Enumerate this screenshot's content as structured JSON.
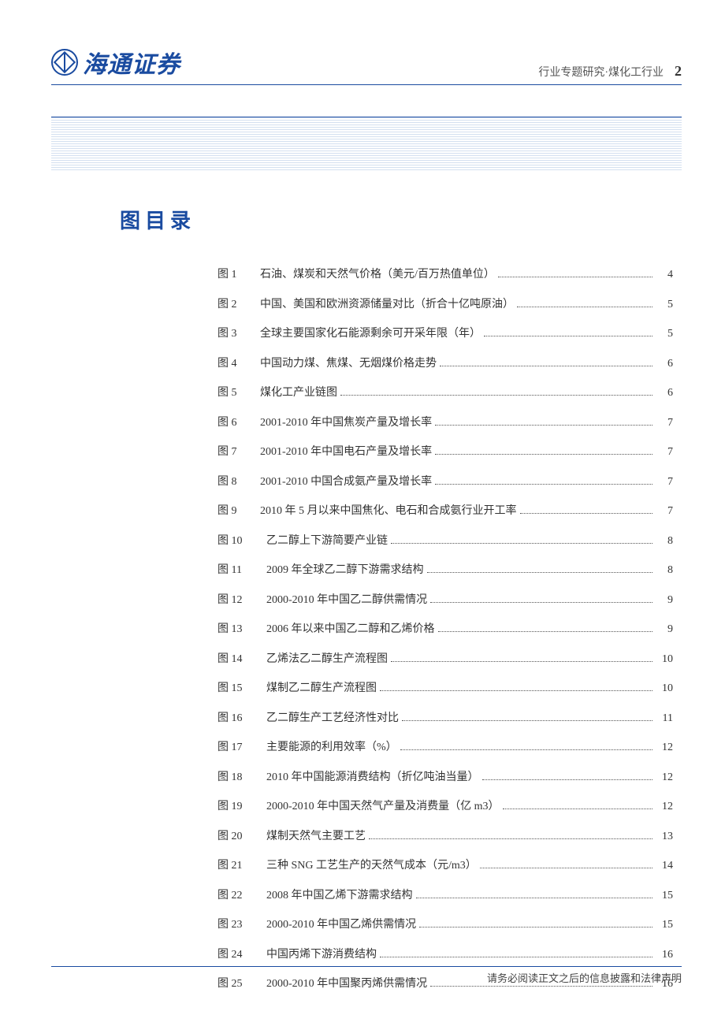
{
  "header": {
    "company": "海通证券",
    "category": "行业专题研究·煤化工行业",
    "page": "2"
  },
  "toc": {
    "title": "图目录",
    "entries": [
      {
        "label": "图 1",
        "text": "石油、煤炭和天然气价格（美元/百万热值单位）",
        "page": "4"
      },
      {
        "label": "图 2",
        "text": "中国、美国和欧洲资源储量对比（折合十亿吨原油）",
        "page": "5"
      },
      {
        "label": "图 3",
        "text": "全球主要国家化石能源剩余可开采年限（年）",
        "page": "5"
      },
      {
        "label": "图 4",
        "text": "中国动力煤、焦煤、无烟煤价格走势",
        "page": "6"
      },
      {
        "label": "图 5",
        "text": "煤化工产业链图",
        "page": "6"
      },
      {
        "label": "图 6",
        "text": "2001-2010 年中国焦炭产量及增长率",
        "page": "7"
      },
      {
        "label": "图 7",
        "text": "2001-2010 年中国电石产量及增长率",
        "page": "7"
      },
      {
        "label": "图 8",
        "text": "2001-2010 中国合成氨产量及增长率",
        "page": "7"
      },
      {
        "label": "图 9",
        "text": "2010 年 5 月以来中国焦化、电石和合成氨行业开工率",
        "page": "7"
      },
      {
        "label": "图 10",
        "text": "乙二醇上下游简要产业链",
        "page": "8"
      },
      {
        "label": "图 11",
        "text": "2009 年全球乙二醇下游需求结构",
        "page": "8"
      },
      {
        "label": "图 12",
        "text": "2000-2010 年中国乙二醇供需情况",
        "page": "9"
      },
      {
        "label": "图 13",
        "text": "2006 年以来中国乙二醇和乙烯价格",
        "page": "9"
      },
      {
        "label": "图 14",
        "text": "乙烯法乙二醇生产流程图",
        "page": "10"
      },
      {
        "label": "图 15",
        "text": "煤制乙二醇生产流程图",
        "page": "10"
      },
      {
        "label": "图 16",
        "text": "乙二醇生产工艺经济性对比",
        "page": "11"
      },
      {
        "label": "图 17",
        "text": "主要能源的利用效率（%）",
        "page": "12"
      },
      {
        "label": "图 18",
        "text": "2010 年中国能源消费结构（折亿吨油当量）",
        "page": "12"
      },
      {
        "label": "图 19",
        "text": "2000-2010 年中国天然气产量及消费量（亿 m3）",
        "page": "12"
      },
      {
        "label": "图 20",
        "text": "煤制天然气主要工艺",
        "page": "13"
      },
      {
        "label": "图 21",
        "text": "三种 SNG 工艺生产的天然气成本（元/m3）",
        "page": "14"
      },
      {
        "label": "图 22",
        "text": "2008 年中国乙烯下游需求结构",
        "page": "15"
      },
      {
        "label": "图 23",
        "text": "2000-2010 年中国乙烯供需情况",
        "page": "15"
      },
      {
        "label": "图 24",
        "text": "中国丙烯下游消费结构",
        "page": "16"
      },
      {
        "label": "图 25",
        "text": "2000-2010 年中国聚丙烯供需情况",
        "page": "16"
      }
    ]
  },
  "footer": {
    "disclaimer": "请务必阅读正文之后的信息披露和法律声明"
  }
}
